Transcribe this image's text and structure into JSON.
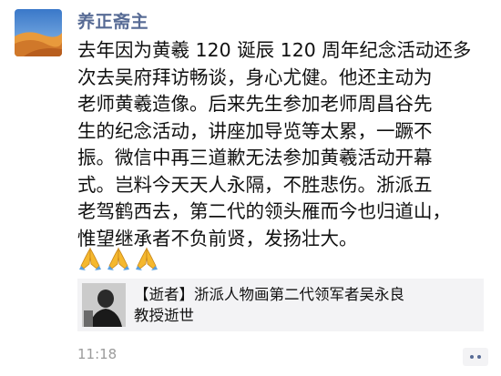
{
  "post": {
    "author": "养正斋主",
    "body_lines": [
      "去年因为黄羲 120 诞辰 120 周年纪念活动还多",
      "次去吴府拜访畅谈，身心尤健。他还主动为",
      "老师黄羲造像。后来先生参加老师周昌谷先",
      "生的纪念活动，讲座加导览等太累，一蹶不",
      "振。微信中再三道歉无法参加黄羲活动开幕",
      "式。岂料今天天人永隔，不胜悲伤。浙派五",
      "老驾鹤西去，第二代的领头雁而今也归道山，",
      "惟望继承者不负前贤，发扬壮大。"
    ],
    "emojis": [
      "pray-icon",
      "pray-icon",
      "pray-icon"
    ],
    "link": {
      "title_line1": "【逝者】浙派人物画第二代领军者吴永良",
      "title_line2": "教授逝世"
    },
    "time": "11:18",
    "more_icon": "more-dots-icon"
  },
  "colors": {
    "author": "#576b95",
    "text": "#111111",
    "card_bg": "#f3f3f5",
    "time": "#9b9b9b"
  }
}
